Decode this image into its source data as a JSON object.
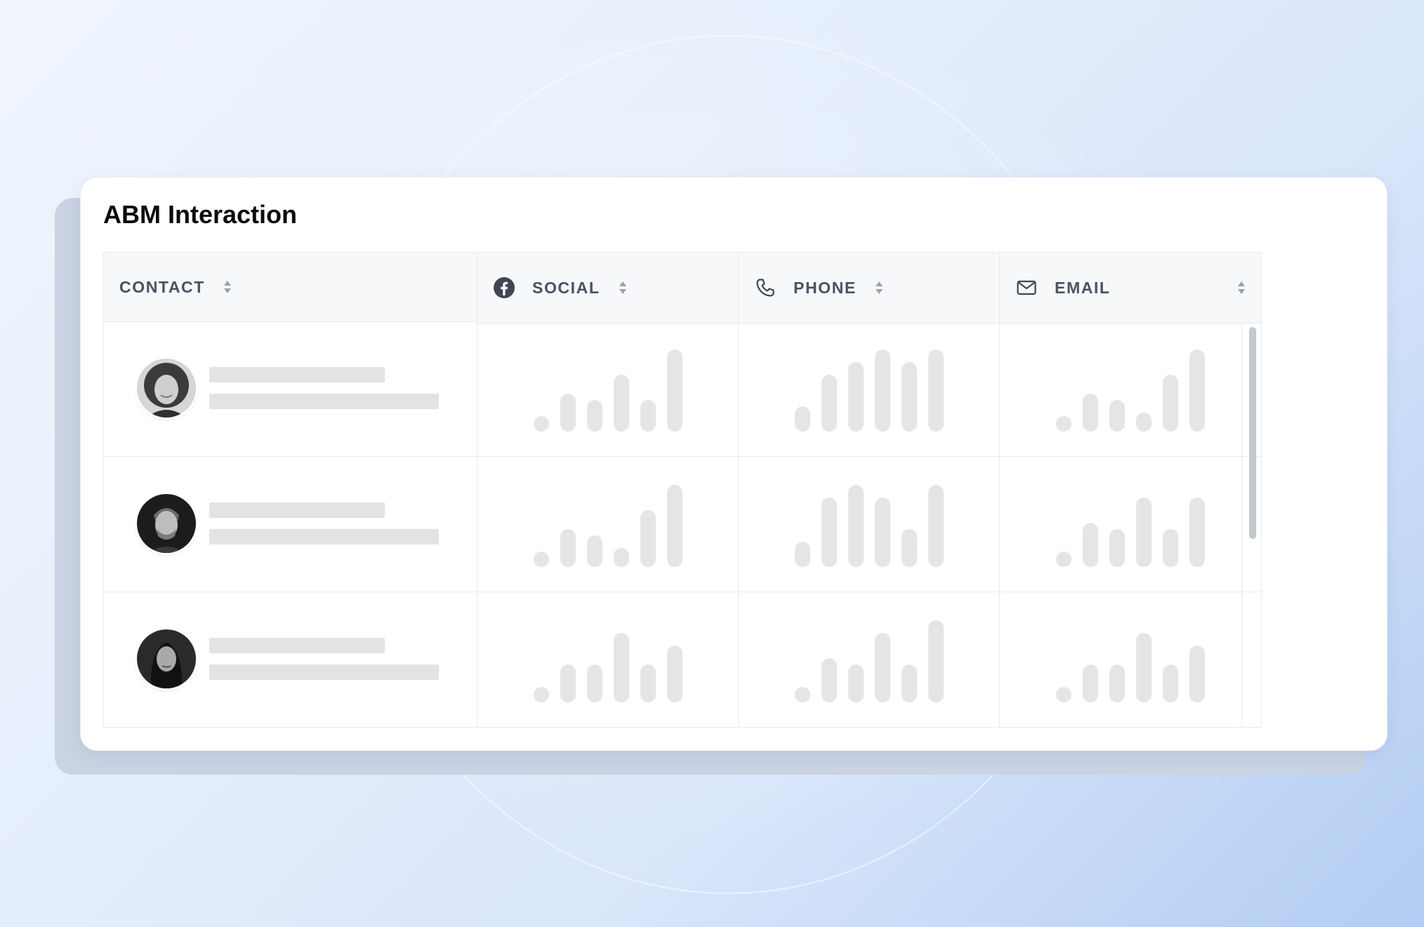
{
  "card": {
    "title": "ABM Interaction"
  },
  "table": {
    "columns": [
      {
        "key": "contact",
        "label": "CONTACT",
        "icon": ""
      },
      {
        "key": "social",
        "label": "SOCIAL",
        "icon": "facebook-icon"
      },
      {
        "key": "phone",
        "label": "PHONE",
        "icon": "phone-icon"
      },
      {
        "key": "email",
        "label": "EMAIL",
        "icon": "mail-icon"
      }
    ],
    "rows": [
      {
        "avatar": "woman-curly-hair-avatar",
        "social": [
          1,
          3,
          2.5,
          4.5,
          2.5,
          6.5
        ],
        "phone": [
          2,
          4.5,
          5.5,
          6.5,
          5.5,
          6.5
        ],
        "email": [
          1,
          3,
          2.5,
          1.5,
          4.5,
          6.5
        ]
      },
      {
        "avatar": "man-bearded-avatar",
        "social": [
          1,
          3,
          2.5,
          1.5,
          4.5,
          6.5
        ],
        "phone": [
          2,
          5.5,
          6.5,
          5.5,
          3,
          6.5
        ],
        "email": [
          1,
          3.5,
          3,
          5.5,
          3,
          5.5
        ]
      },
      {
        "avatar": "woman-dark-hair-avatar",
        "social": [
          1,
          3,
          3,
          5.5,
          3,
          4.5
        ],
        "phone": [
          1,
          3.5,
          3,
          5.5,
          3,
          6.5
        ],
        "email": [
          1,
          3,
          3,
          5.5,
          3,
          4.5
        ]
      }
    ]
  },
  "colors": {
    "placeholder": "#e5e5e5",
    "header_text": "#4a5260",
    "title": "#0b0b0f"
  }
}
